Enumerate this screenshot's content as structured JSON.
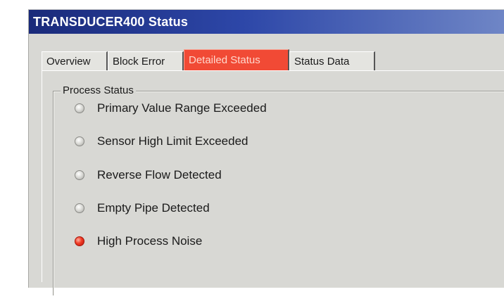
{
  "window": {
    "title": "TRANSDUCER400 Status"
  },
  "tabs": [
    {
      "label": "Overview",
      "active": false
    },
    {
      "label": "Block Error",
      "active": false
    },
    {
      "label": "Detailed Status",
      "active": true
    },
    {
      "label": "Status Data",
      "active": false
    }
  ],
  "process_status": {
    "legend": "Process Status",
    "items": [
      {
        "label": "Primary Value Range Exceeded",
        "active": false
      },
      {
        "label": "Sensor High Limit Exceeded",
        "active": false
      },
      {
        "label": "Reverse Flow Detected",
        "active": false
      },
      {
        "label": "Empty Pipe Detected",
        "active": false
      },
      {
        "label": "High Process Noise",
        "active": true
      }
    ]
  },
  "colors": {
    "active_tab": "#f14a35",
    "led_on": "#f03a24",
    "led_off": "#dcdcd8",
    "titlebar": "#2d47a8"
  }
}
